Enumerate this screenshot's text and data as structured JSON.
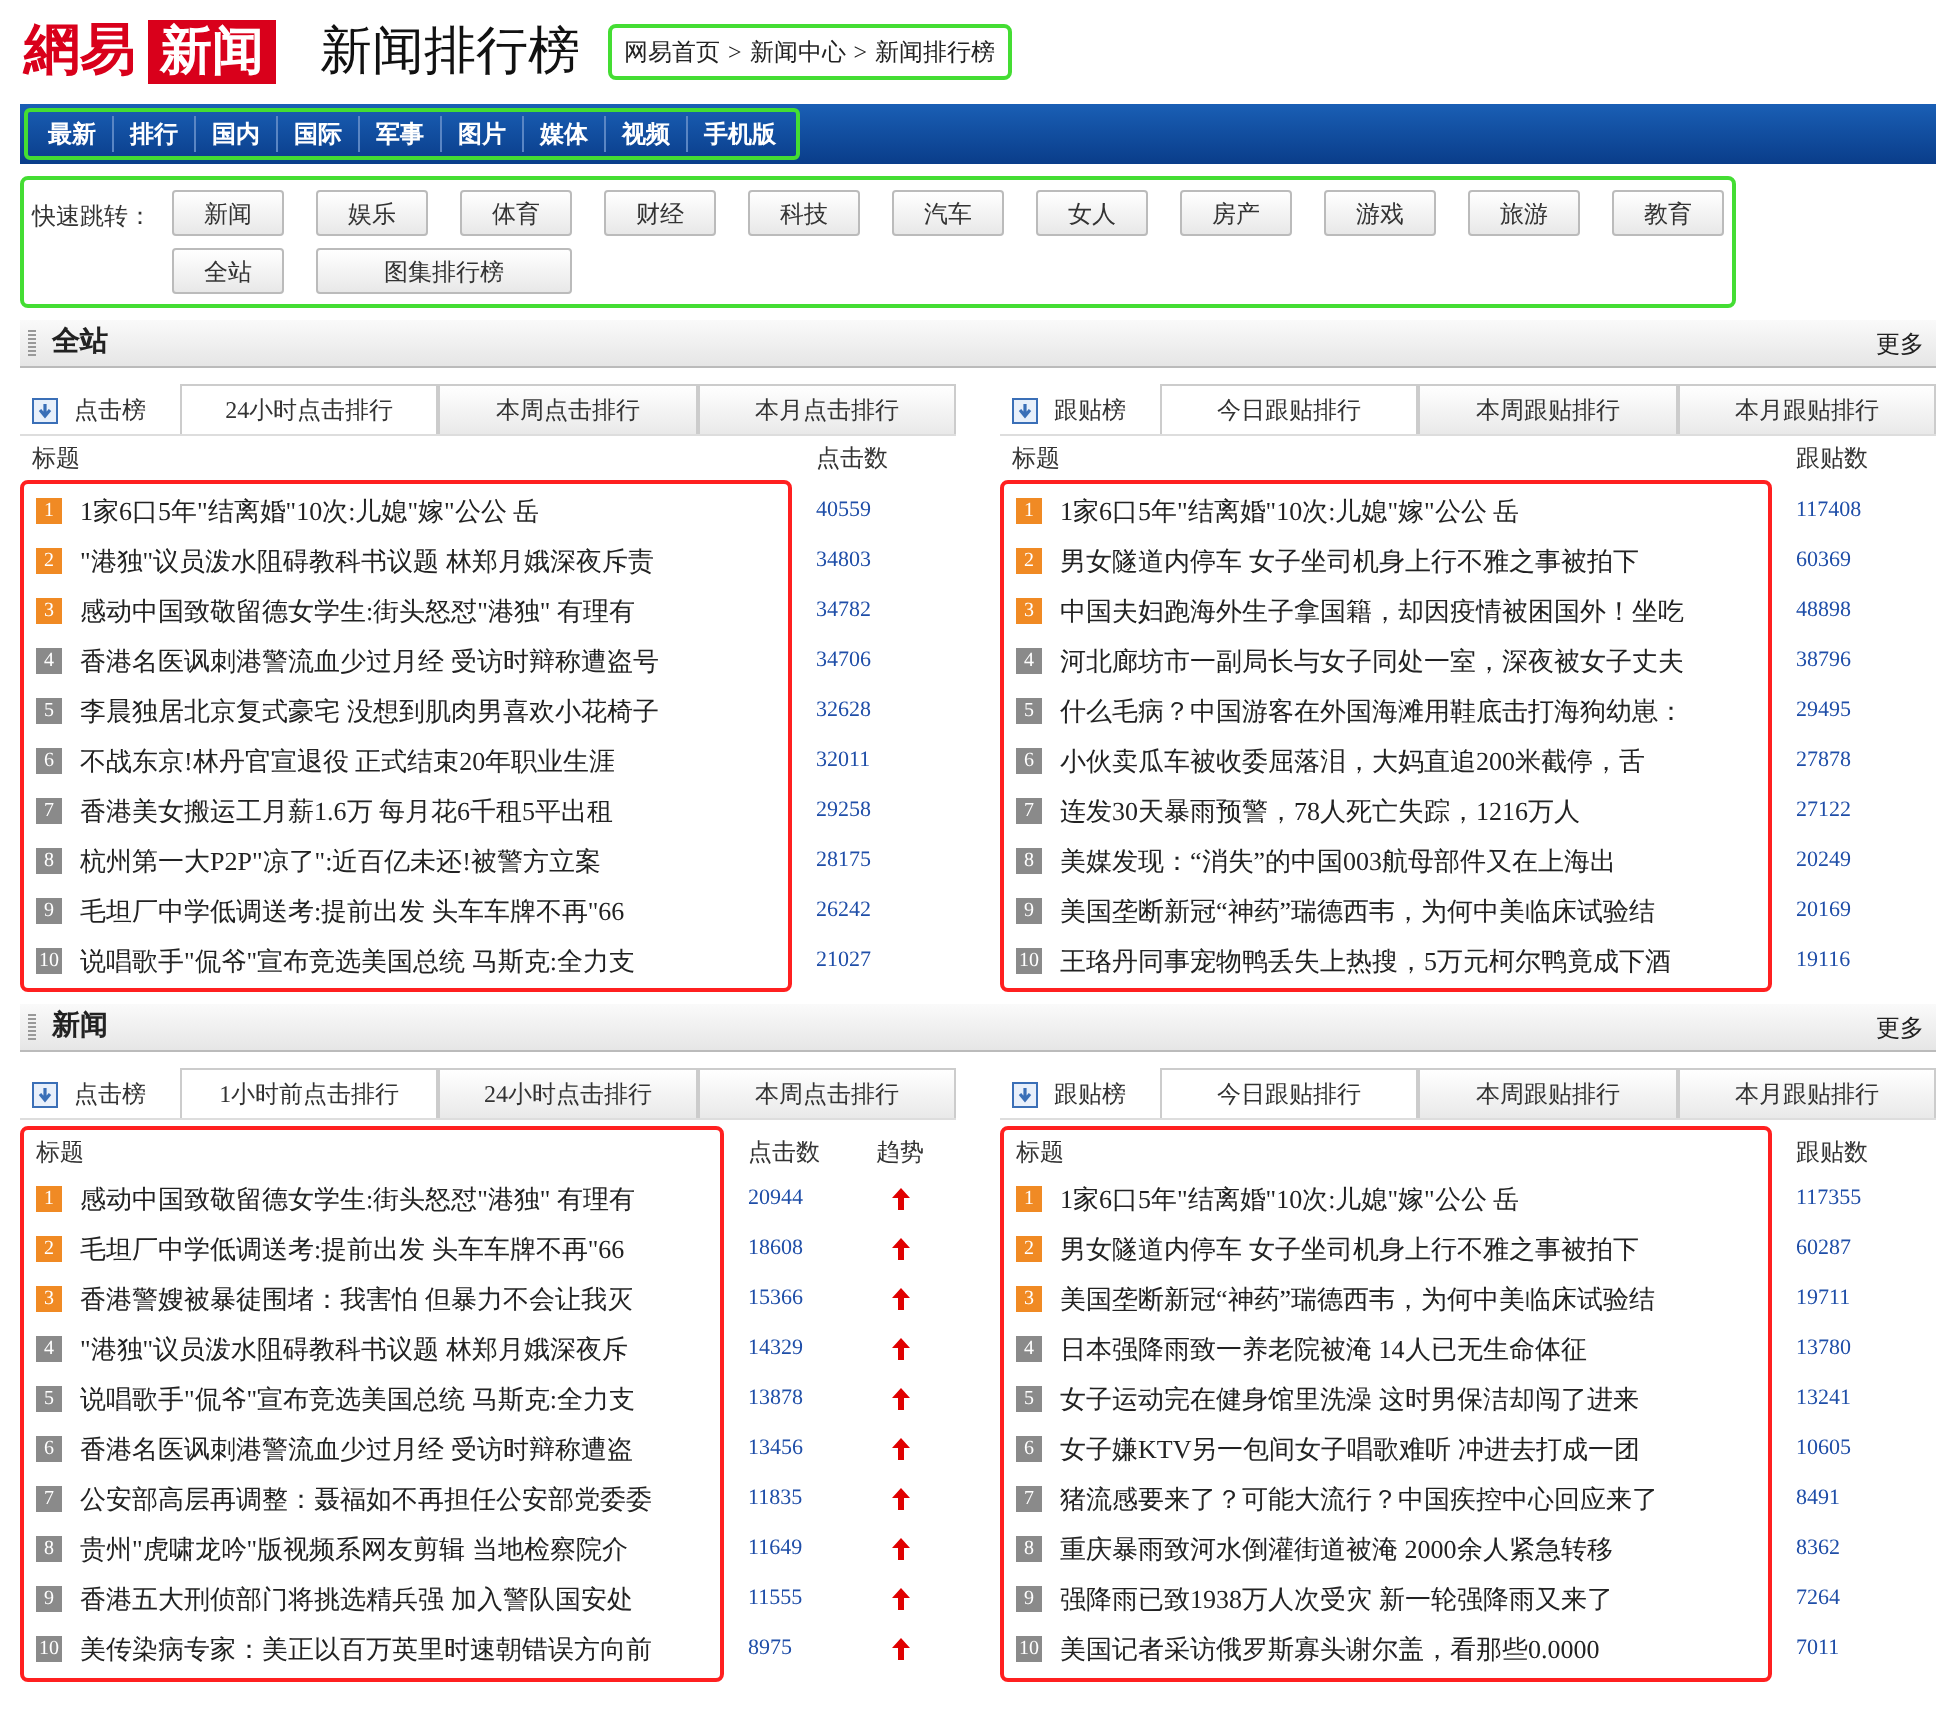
{
  "logo": {
    "brand": "網易",
    "product": "新闻"
  },
  "page_title": "新闻排行榜",
  "breadcrumb": [
    "网易首页",
    "新闻中心",
    "新闻排行榜"
  ],
  "breadcrumb_separator": ">",
  "nav": [
    "最新",
    "排行",
    "国内",
    "国际",
    "军事",
    "图片",
    "媒体",
    "视频",
    "手机版"
  ],
  "quick_jump": {
    "label": "快速跳转：",
    "rows": [
      [
        "新闻",
        "娱乐",
        "体育",
        "财经",
        "科技",
        "汽车",
        "女人",
        "房产",
        "游戏",
        "旅游",
        "教育"
      ],
      [
        "全站",
        "图集排行榜"
      ]
    ]
  },
  "sections": [
    {
      "title": "全站",
      "more": "更多",
      "panels": [
        {
          "label": "点击榜",
          "frame_includes_header": false,
          "tabs": [
            {
              "label": "24小时点击排行",
              "selected": true
            },
            {
              "label": "本周点击排行",
              "selected": false
            },
            {
              "label": "本月点击排行",
              "selected": false
            }
          ],
          "columns": [
            "标题",
            "点击数"
          ],
          "rows": [
            {
              "rank": "1",
              "hot": true,
              "title": "1家6口5年\"结离婚\"10次:儿媳\"嫁\"公公 岳",
              "count": "40559"
            },
            {
              "rank": "2",
              "hot": true,
              "title": "\"港独\"议员泼水阻碍教科书议题 林郑月娥深夜斥责",
              "count": "34803"
            },
            {
              "rank": "3",
              "hot": true,
              "title": "感动中国致敬留德女学生:街头怒怼\"港独\" 有理有",
              "count": "34782"
            },
            {
              "rank": "4",
              "hot": false,
              "title": "香港名医讽刺港警流血少过月经 受访时辩称遭盗号",
              "count": "34706"
            },
            {
              "rank": "5",
              "hot": false,
              "title": "李晨独居北京复式豪宅 没想到肌肉男喜欢小花椅子",
              "count": "32628"
            },
            {
              "rank": "6",
              "hot": false,
              "title": "不战东京!林丹官宣退役 正式结束20年职业生涯",
              "count": "32011"
            },
            {
              "rank": "7",
              "hot": false,
              "title": "香港美女搬运工月薪1.6万 每月花6千租5平出租",
              "count": "29258"
            },
            {
              "rank": "8",
              "hot": false,
              "title": "杭州第一大P2P\"凉了\":近百亿未还!被警方立案",
              "count": "28175"
            },
            {
              "rank": "9",
              "hot": false,
              "title": "毛坦厂中学低调送考:提前出发 头车车牌不再\"66",
              "count": "26242"
            },
            {
              "rank": "10",
              "hot": false,
              "title": "说唱歌手\"侃爷\"宣布竞选美国总统 马斯克:全力支",
              "count": "21027"
            }
          ]
        },
        {
          "label": "跟贴榜",
          "frame_includes_header": false,
          "tabs": [
            {
              "label": "今日跟贴排行",
              "selected": true
            },
            {
              "label": "本周跟贴排行",
              "selected": false
            },
            {
              "label": "本月跟贴排行",
              "selected": false
            }
          ],
          "columns": [
            "标题",
            "跟贴数"
          ],
          "rows": [
            {
              "rank": "1",
              "hot": true,
              "title": "1家6口5年\"结离婚\"10次:儿媳\"嫁\"公公 岳",
              "count": "117408"
            },
            {
              "rank": "2",
              "hot": true,
              "title": "男女隧道内停车 女子坐司机身上行不雅之事被拍下",
              "count": "60369"
            },
            {
              "rank": "3",
              "hot": true,
              "title": "中国夫妇跑海外生子拿国籍，却因疫情被困国外！坐吃",
              "count": "48898"
            },
            {
              "rank": "4",
              "hot": false,
              "title": "河北廊坊市一副局长与女子同处一室，深夜被女子丈夫",
              "count": "38796"
            },
            {
              "rank": "5",
              "hot": false,
              "title": "什么毛病？中国游客在外国海滩用鞋底击打海狗幼崽：",
              "count": "29495"
            },
            {
              "rank": "6",
              "hot": false,
              "title": "小伙卖瓜车被收委屈落泪，大妈直追200米截停，舌",
              "count": "27878"
            },
            {
              "rank": "7",
              "hot": false,
              "title": "连发30天暴雨预警，78人死亡失踪，1216万人",
              "count": "27122"
            },
            {
              "rank": "8",
              "hot": false,
              "title": "美媒发现：“消失”的中国003航母部件又在上海出",
              "count": "20249"
            },
            {
              "rank": "9",
              "hot": false,
              "title": "美国垄断新冠“神药”瑞德西韦，为何中美临床试验结",
              "count": "20169"
            },
            {
              "rank": "10",
              "hot": false,
              "title": "王珞丹同事宠物鸭丢失上热搜，5万元柯尔鸭竟成下酒",
              "count": "19116"
            }
          ]
        }
      ]
    },
    {
      "title": "新闻",
      "more": "更多",
      "panels": [
        {
          "label": "点击榜",
          "frame_includes_header": true,
          "tabs": [
            {
              "label": "1小时前点击排行",
              "selected": true
            },
            {
              "label": "24小时点击排行",
              "selected": false
            },
            {
              "label": "本周点击排行",
              "selected": false
            }
          ],
          "columns": [
            "标题",
            "点击数",
            "趋势"
          ],
          "rows": [
            {
              "rank": "1",
              "hot": true,
              "title": "感动中国致敬留德女学生:街头怒怼\"港独\" 有理有",
              "count": "20944",
              "kind": "rising"
            },
            {
              "rank": "2",
              "hot": true,
              "title": "毛坦厂中学低调送考:提前出发 头车车牌不再\"66",
              "count": "18608",
              "kind": "rising"
            },
            {
              "rank": "3",
              "hot": true,
              "title": "香港警嫂被暴徒围堵：我害怕 但暴力不会让我灭",
              "count": "15366",
              "kind": "rising"
            },
            {
              "rank": "4",
              "hot": false,
              "title": "\"港独\"议员泼水阻碍教科书议题 林郑月娥深夜斥",
              "count": "14329",
              "kind": "rising"
            },
            {
              "rank": "5",
              "hot": false,
              "title": "说唱歌手\"侃爷\"宣布竞选美国总统 马斯克:全力支",
              "count": "13878",
              "kind": "rising"
            },
            {
              "rank": "6",
              "hot": false,
              "title": "香港名医讽刺港警流血少过月经 受访时辩称遭盗",
              "count": "13456",
              "kind": "rising"
            },
            {
              "rank": "7",
              "hot": false,
              "title": "公安部高层再调整：聂福如不再担任公安部党委委",
              "count": "11835",
              "kind": "rising"
            },
            {
              "rank": "8",
              "hot": false,
              "title": "贵州\"虎啸龙吟\"版视频系网友剪辑 当地检察院介",
              "count": "11649",
              "kind": "rising"
            },
            {
              "rank": "9",
              "hot": false,
              "title": "香港五大刑侦部门将挑选精兵强 加入警队国安处",
              "count": "11555",
              "kind": "rising"
            },
            {
              "rank": "10",
              "hot": false,
              "title": "美传染病专家：美正以百万英里时速朝错误方向前",
              "count": "8975",
              "kind": "rising"
            }
          ]
        },
        {
          "label": "跟贴榜",
          "frame_includes_header": true,
          "tabs": [
            {
              "label": "今日跟贴排行",
              "selected": true
            },
            {
              "label": "本周跟贴排行",
              "selected": false
            },
            {
              "label": "本月跟贴排行",
              "selected": false
            }
          ],
          "columns": [
            "标题",
            "跟贴数"
          ],
          "rows": [
            {
              "rank": "1",
              "hot": true,
              "title": "1家6口5年\"结离婚\"10次:儿媳\"嫁\"公公 岳",
              "count": "117355"
            },
            {
              "rank": "2",
              "hot": true,
              "title": "男女隧道内停车 女子坐司机身上行不雅之事被拍下",
              "count": "60287"
            },
            {
              "rank": "3",
              "hot": true,
              "title": "美国垄断新冠“神药”瑞德西韦，为何中美临床试验结",
              "count": "19711"
            },
            {
              "rank": "4",
              "hot": false,
              "title": "日本强降雨致一养老院被淹 14人已无生命体征",
              "count": "13780"
            },
            {
              "rank": "5",
              "hot": false,
              "title": "女子运动完在健身馆里洗澡 这时男保洁却闯了进来",
              "count": "13241"
            },
            {
              "rank": "6",
              "hot": false,
              "title": "女子嫌KTV另一包间女子唱歌难听 冲进去打成一团",
              "count": "10605"
            },
            {
              "rank": "7",
              "hot": false,
              "title": "猪流感要来了？可能大流行？中国疾控中心回应来了",
              "count": "8491"
            },
            {
              "rank": "8",
              "hot": false,
              "title": "重庆暴雨致河水倒灌街道被淹 2000余人紧急转移",
              "count": "8362"
            },
            {
              "rank": "9",
              "hot": false,
              "title": "强降雨已致1938万人次受灾 新一轮强降雨又来了",
              "count": "7264"
            },
            {
              "rank": "10",
              "hot": false,
              "title": "美国记者采访俄罗斯寡头谢尔盖，看那些0.0000",
              "count": "7011"
            }
          ]
        }
      ]
    }
  ]
}
